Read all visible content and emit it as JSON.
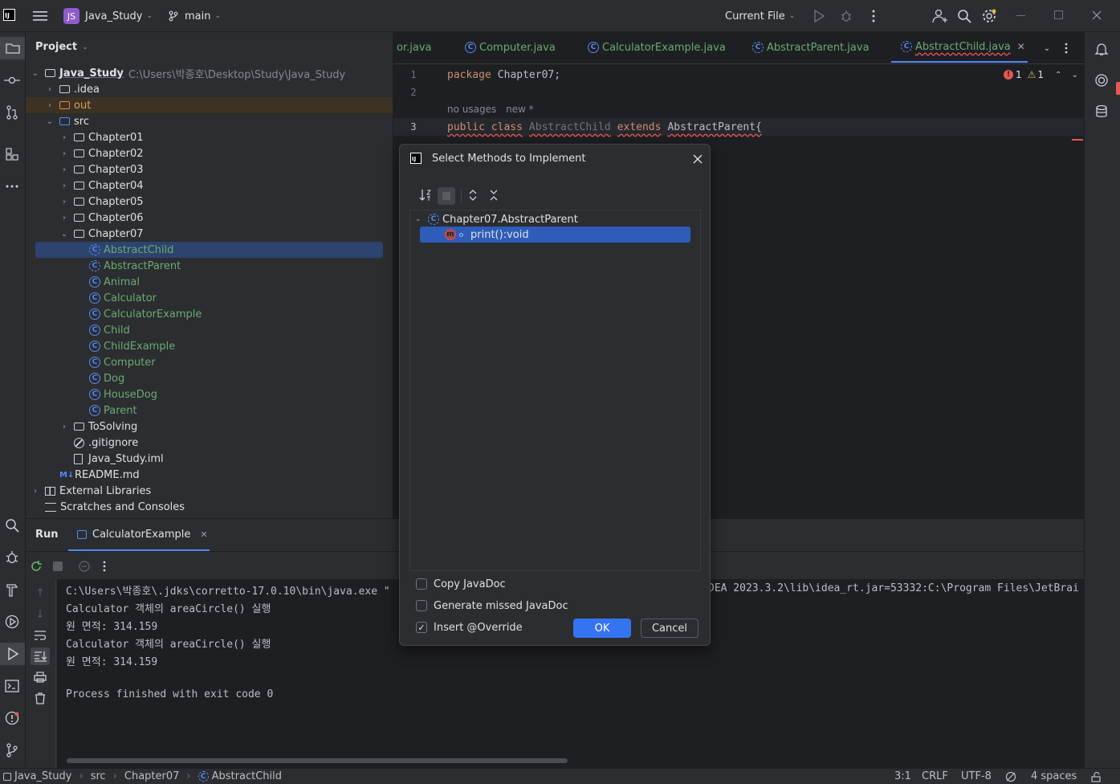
{
  "topbar": {
    "project_badge": "JS",
    "project_name": "Java_Study",
    "branch": "main",
    "run_config": "Current File"
  },
  "project_panel": {
    "title": "Project",
    "root_name": "Java_Study",
    "root_path": "C:\\Users\\박종호\\Desktop\\Study\\Java_Study",
    "items": [
      {
        "label": ".idea"
      },
      {
        "label": "out"
      },
      {
        "label": "src"
      },
      {
        "label": "Chapter01"
      },
      {
        "label": "Chapter02"
      },
      {
        "label": "Chapter03"
      },
      {
        "label": "Chapter04"
      },
      {
        "label": "Chapter05"
      },
      {
        "label": "Chapter06"
      },
      {
        "label": "Chapter07"
      },
      {
        "label": "AbstractChild"
      },
      {
        "label": "AbstractParent"
      },
      {
        "label": "Animal"
      },
      {
        "label": "Calculator"
      },
      {
        "label": "CalculatorExample"
      },
      {
        "label": "Child"
      },
      {
        "label": "ChildExample"
      },
      {
        "label": "Computer"
      },
      {
        "label": "Dog"
      },
      {
        "label": "HouseDog"
      },
      {
        "label": "Parent"
      },
      {
        "label": "ToSolving"
      },
      {
        "label": ".gitignore"
      },
      {
        "label": "Java_Study.iml"
      },
      {
        "label": "README.md"
      },
      {
        "label": "External Libraries"
      },
      {
        "label": "Scratches and Consoles"
      }
    ]
  },
  "editor": {
    "tabs": [
      "or.java",
      "Computer.java",
      "CalculatorExample.java",
      "AbstractParent.java",
      "AbstractChild.java"
    ],
    "errors": "1",
    "warnings": "1",
    "line1_kw": "package",
    "line1_rest": "Chapter07;",
    "inlay_usages": "no usages",
    "inlay_new": "new *",
    "line3_kw1": "public class",
    "line3_name": "AbstractChild",
    "line3_kw2": "extends",
    "line3_parent": "AbstractParent{",
    "line_numbers": [
      "1",
      "2",
      "3"
    ]
  },
  "run_panel": {
    "title": "Run",
    "tab_label": "CalculatorExample",
    "console": [
      "C:\\Users\\박종호\\.jdks\\corretto-17.0.10\\bin\\java.exe \"",
      "Calculator 객체의 areaCircle() 실행",
      "원 면적: 314.159",
      "Calculator 객체의 areaCircle() 실행",
      "원 면적: 314.159",
      "",
      "Process finished with exit code 0"
    ],
    "console_right": "DEA 2023.3.2\\lib\\idea_rt.jar=53332:C:\\Program Files\\JetBrai"
  },
  "dialog": {
    "title": "Select Methods to Implement",
    "class_node": "Chapter07.AbstractParent",
    "method": "print():void",
    "copy_javadoc": "Copy JavaDoc",
    "generate_javadoc": "Generate missed JavaDoc",
    "insert_override": "Insert @Override",
    "ok": "OK",
    "cancel": "Cancel",
    "insert_override_checked": true
  },
  "statusbar": {
    "crumbs": [
      "Java_Study",
      "src",
      "Chapter07",
      "AbstractChild"
    ],
    "position": "3:1",
    "line_sep": "CRLF",
    "encoding": "UTF-8",
    "indent": "4 spaces"
  },
  "colors": {
    "accent": "#548af7",
    "selection": "#2e436e",
    "class_green": "#6aab73",
    "keyword": "#cf8e6d",
    "error": "#e55757",
    "warning": "#e6b84a"
  }
}
